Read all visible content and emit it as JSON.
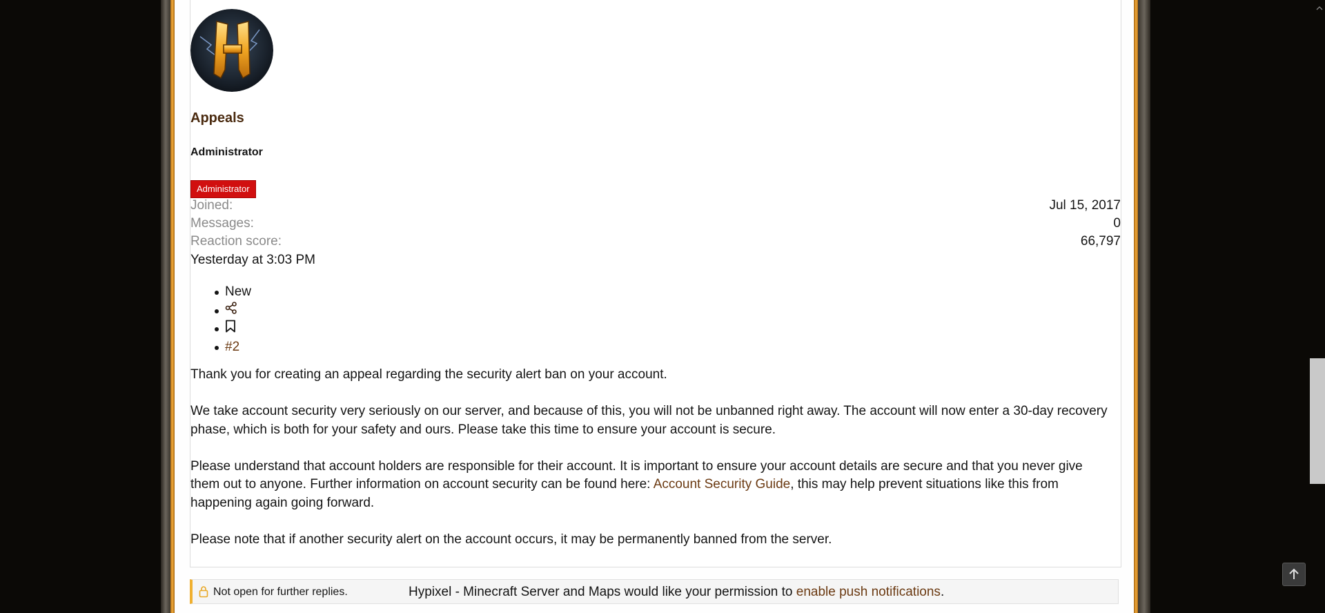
{
  "post": {
    "username": "Appeals",
    "user_title": "Administrator",
    "banner": "Administrator",
    "stats": [
      {
        "label": "Joined:",
        "value": "Jul 15, 2017"
      },
      {
        "label": "Messages:",
        "value": "0"
      },
      {
        "label": "Reaction score:",
        "value": "66,797"
      }
    ],
    "date": "Yesterday at 3:03 PM",
    "actions": {
      "new_label": "New",
      "share_icon": "share-icon",
      "bookmark_icon": "bookmark-icon",
      "post_number": "#2"
    },
    "body": {
      "p1": "Thank you for creating an appeal regarding the security alert ban on your account.",
      "p2": "We take account security very seriously on our server, and because of this, you will not be unbanned right away. The account will now enter a 30-day recovery phase, which is both for your safety and ours. Please take this time to ensure your account is secure.",
      "p3_before": "Please understand that account holders are responsible for their account. It is important to ensure your account details are secure and that you never give them out to anyone. Further information on account security can be found here: ",
      "p3_link": "Account Security Guide",
      "p3_after": ", this may help prevent situations like this from happening again going forward.",
      "p4": "Please note that if another security alert on the account occurs, it may be permanently banned from the server."
    }
  },
  "thread_status": {
    "icon": "lock-icon",
    "text": "Not open for further replies."
  },
  "push_notice": {
    "before": "Hypixel - Minecraft Server and Maps would like your permission to ",
    "link": "enable push notifications",
    "after": "."
  },
  "colors": {
    "accent_brown": "#6b3a12",
    "banner_red": "#d10f0f",
    "frame_gold": "#f0a83a"
  }
}
